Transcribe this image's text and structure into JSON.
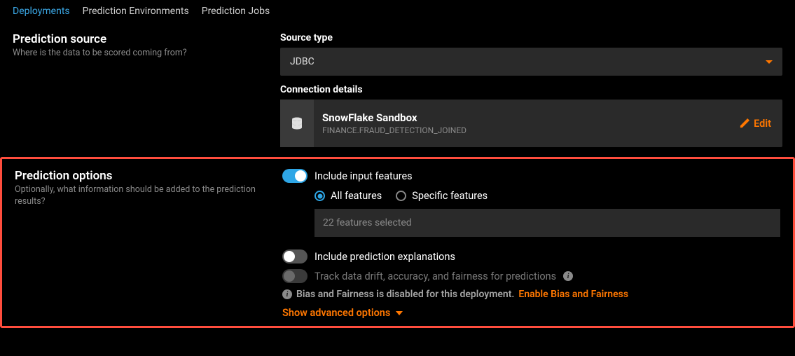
{
  "tabs": {
    "deployments": "Deployments",
    "prediction_environments": "Prediction Environments",
    "prediction_jobs": "Prediction Jobs"
  },
  "prediction_source": {
    "title": "Prediction source",
    "description": "Where is the data to be scored coming from?",
    "source_type_label": "Source type",
    "source_type_value": "JDBC",
    "connection_details_label": "Connection details",
    "connection_name": "SnowFlake Sandbox",
    "connection_path": "FINANCE.FRAUD_DETECTION_JOINED",
    "edit_label": "Edit"
  },
  "prediction_options": {
    "title": "Prediction options",
    "description": "Optionally, what information should be added to the prediction results?",
    "include_features_label": "Include input features",
    "all_features_label": "All features",
    "specific_features_label": "Specific features",
    "features_selected_text": "22 features selected",
    "include_explanations_label": "Include prediction explanations",
    "track_drift_label": "Track data drift, accuracy, and fairness for predictions",
    "bias_disabled_text": "Bias and Fairness is disabled for this deployment.",
    "enable_bias_link": "Enable Bias and Fairness",
    "show_advanced_label": "Show advanced options"
  }
}
